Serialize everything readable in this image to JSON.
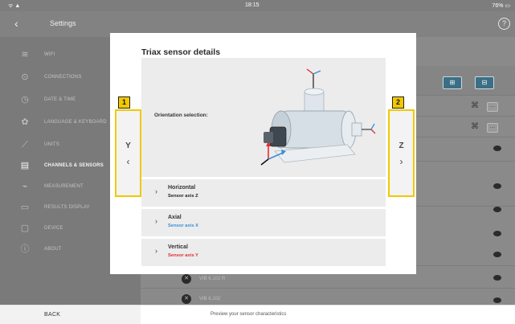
{
  "status": {
    "left": "ᯤ ▲",
    "time": "18:15",
    "right": "76% ▭"
  },
  "header": {
    "title": "Settings",
    "help": "?"
  },
  "sidebar": {
    "items": [
      {
        "label": "WIFI",
        "icon": "wifi-icon",
        "glyph": "≋"
      },
      {
        "label": "CONNECTIONS",
        "icon": "connections-icon",
        "glyph": "⊙"
      },
      {
        "label": "DATE & TIME",
        "icon": "clock-icon",
        "glyph": "◷"
      },
      {
        "label": "LANGUAGE & KEYBOARD",
        "icon": "language-icon",
        "glyph": "✿"
      },
      {
        "label": "UNITS",
        "icon": "ruler-icon",
        "glyph": "⟋"
      },
      {
        "label": "CHANNELS & SENSORS",
        "icon": "channels-icon",
        "glyph": "▤"
      },
      {
        "label": "MEASUREMENT",
        "icon": "measurement-icon",
        "glyph": "⌁"
      },
      {
        "label": "RESULTS DISPLAY",
        "icon": "results-icon",
        "glyph": "▭"
      },
      {
        "label": "DEVICE",
        "icon": "device-icon",
        "glyph": "▢"
      },
      {
        "label": "ABOUT",
        "icon": "info-icon",
        "glyph": "ⓘ"
      }
    ]
  },
  "background_rows": [
    {
      "label": "VIB 6.102 R"
    },
    {
      "label": "VIB 6.102"
    }
  ],
  "modal": {
    "title": "Triax sensor details",
    "orientation_label": "Orientation selection:",
    "left_button": {
      "axis": "Y",
      "chevron": "‹",
      "badge": "1"
    },
    "right_button": {
      "axis": "Z",
      "chevron": "›",
      "badge": "2"
    },
    "options": [
      {
        "name": "Horizontal",
        "sub": "Sensor axis Z",
        "color": "#222222"
      },
      {
        "name": "Axial",
        "sub": "Sensor axis X",
        "color": "#3a8fd6"
      },
      {
        "name": "Vertical",
        "sub": "Sensor axis Y",
        "color": "#e03030"
      }
    ],
    "colors": {
      "badge": "#f2c800",
      "axis_x": "#3a8fd6",
      "axis_y": "#e03030",
      "axis_z": "#222222"
    }
  },
  "bottom": {
    "back_label": "BACK",
    "hint": "Preview your sensor characteristics"
  }
}
